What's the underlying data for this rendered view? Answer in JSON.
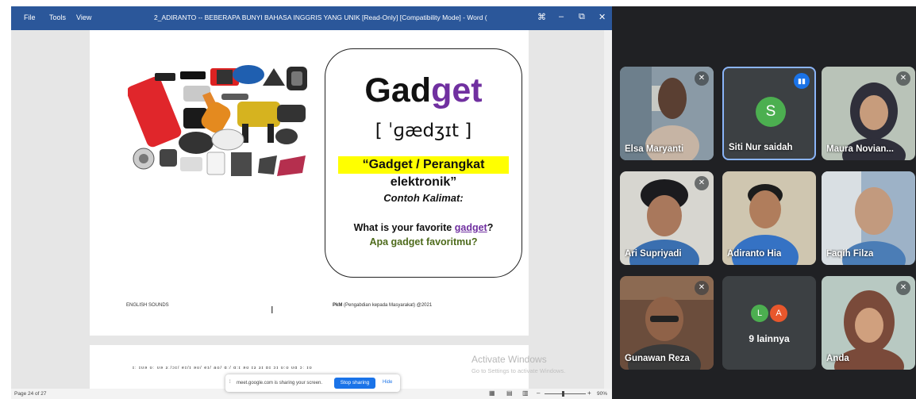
{
  "word": {
    "menu": [
      "File",
      "Tools",
      "View"
    ],
    "title": "2_ADIRANTO -- BEBERAPA BUNYI BAHASA INGGRIS YANG UNIK [Read-Only] [Compatibility Mode] - Word (Product Activation Failed)",
    "controls": [
      "⌘",
      "–",
      "⧉",
      "✕"
    ],
    "status": {
      "page": "Page 24 of 27",
      "zoom": "90%"
    },
    "footer_left": "ENGLISH SOUNDS",
    "footer_right_bold": "PkM",
    "footer_right_rest": " (Pengabdian kepada Masyarakat) @2021",
    "page2_text": "ɪː ɪʊə ʊː   ʊə ɜː/ɔɪ/ eɪ/ɪ əʊ/ eɪ/ aʊ/ ɑː/ ɑ:ɪ  ǝʊ  ɪɜ  ɜɪ  ɒɪ  ɔɪ ʊ:ʊ  ʊɑ  ɔː  ɪʊ ",
    "activate_title": "Activate Windows",
    "activate_sub": "Go to Settings to activate Windows.",
    "card": {
      "word_part1": "Gad",
      "word_part2": "get",
      "ipa": "[ ˈɡædʒɪt ]",
      "meaning": "“Gadget / Perangkat elektronik”",
      "contoh": "Contoh Kalimat:",
      "question_pre": "What is your favorite ",
      "question_link": "gadget",
      "question_post": "?",
      "answer": "Apa gadget favoritmu?"
    }
  },
  "share_bar": {
    "message": "meet.google.com is sharing your screen.",
    "stop": "Stop sharing",
    "hide": "Hide"
  },
  "meet": {
    "participants": [
      {
        "name": "Elsa Maryanti",
        "muted": true
      },
      {
        "name": "Siti Nur saidah",
        "initial": "S",
        "speaking": true
      },
      {
        "name": "Maura Novian...",
        "muted": true
      },
      {
        "name": "Ari Supriyadi",
        "muted": true
      },
      {
        "name": "Adiranto Hia"
      },
      {
        "name": "Faqih Filza"
      },
      {
        "name": "Gunawan Reza",
        "muted": true
      },
      {
        "name": "9 lainnya",
        "initials": [
          "L",
          "A"
        ]
      },
      {
        "name": "Anda",
        "muted": true
      }
    ],
    "colors": {
      "speaking": "#1a73e8",
      "avatar_s": "#4caf50",
      "avatar_l": "#4caf50",
      "avatar_a": "#e8572c"
    }
  }
}
